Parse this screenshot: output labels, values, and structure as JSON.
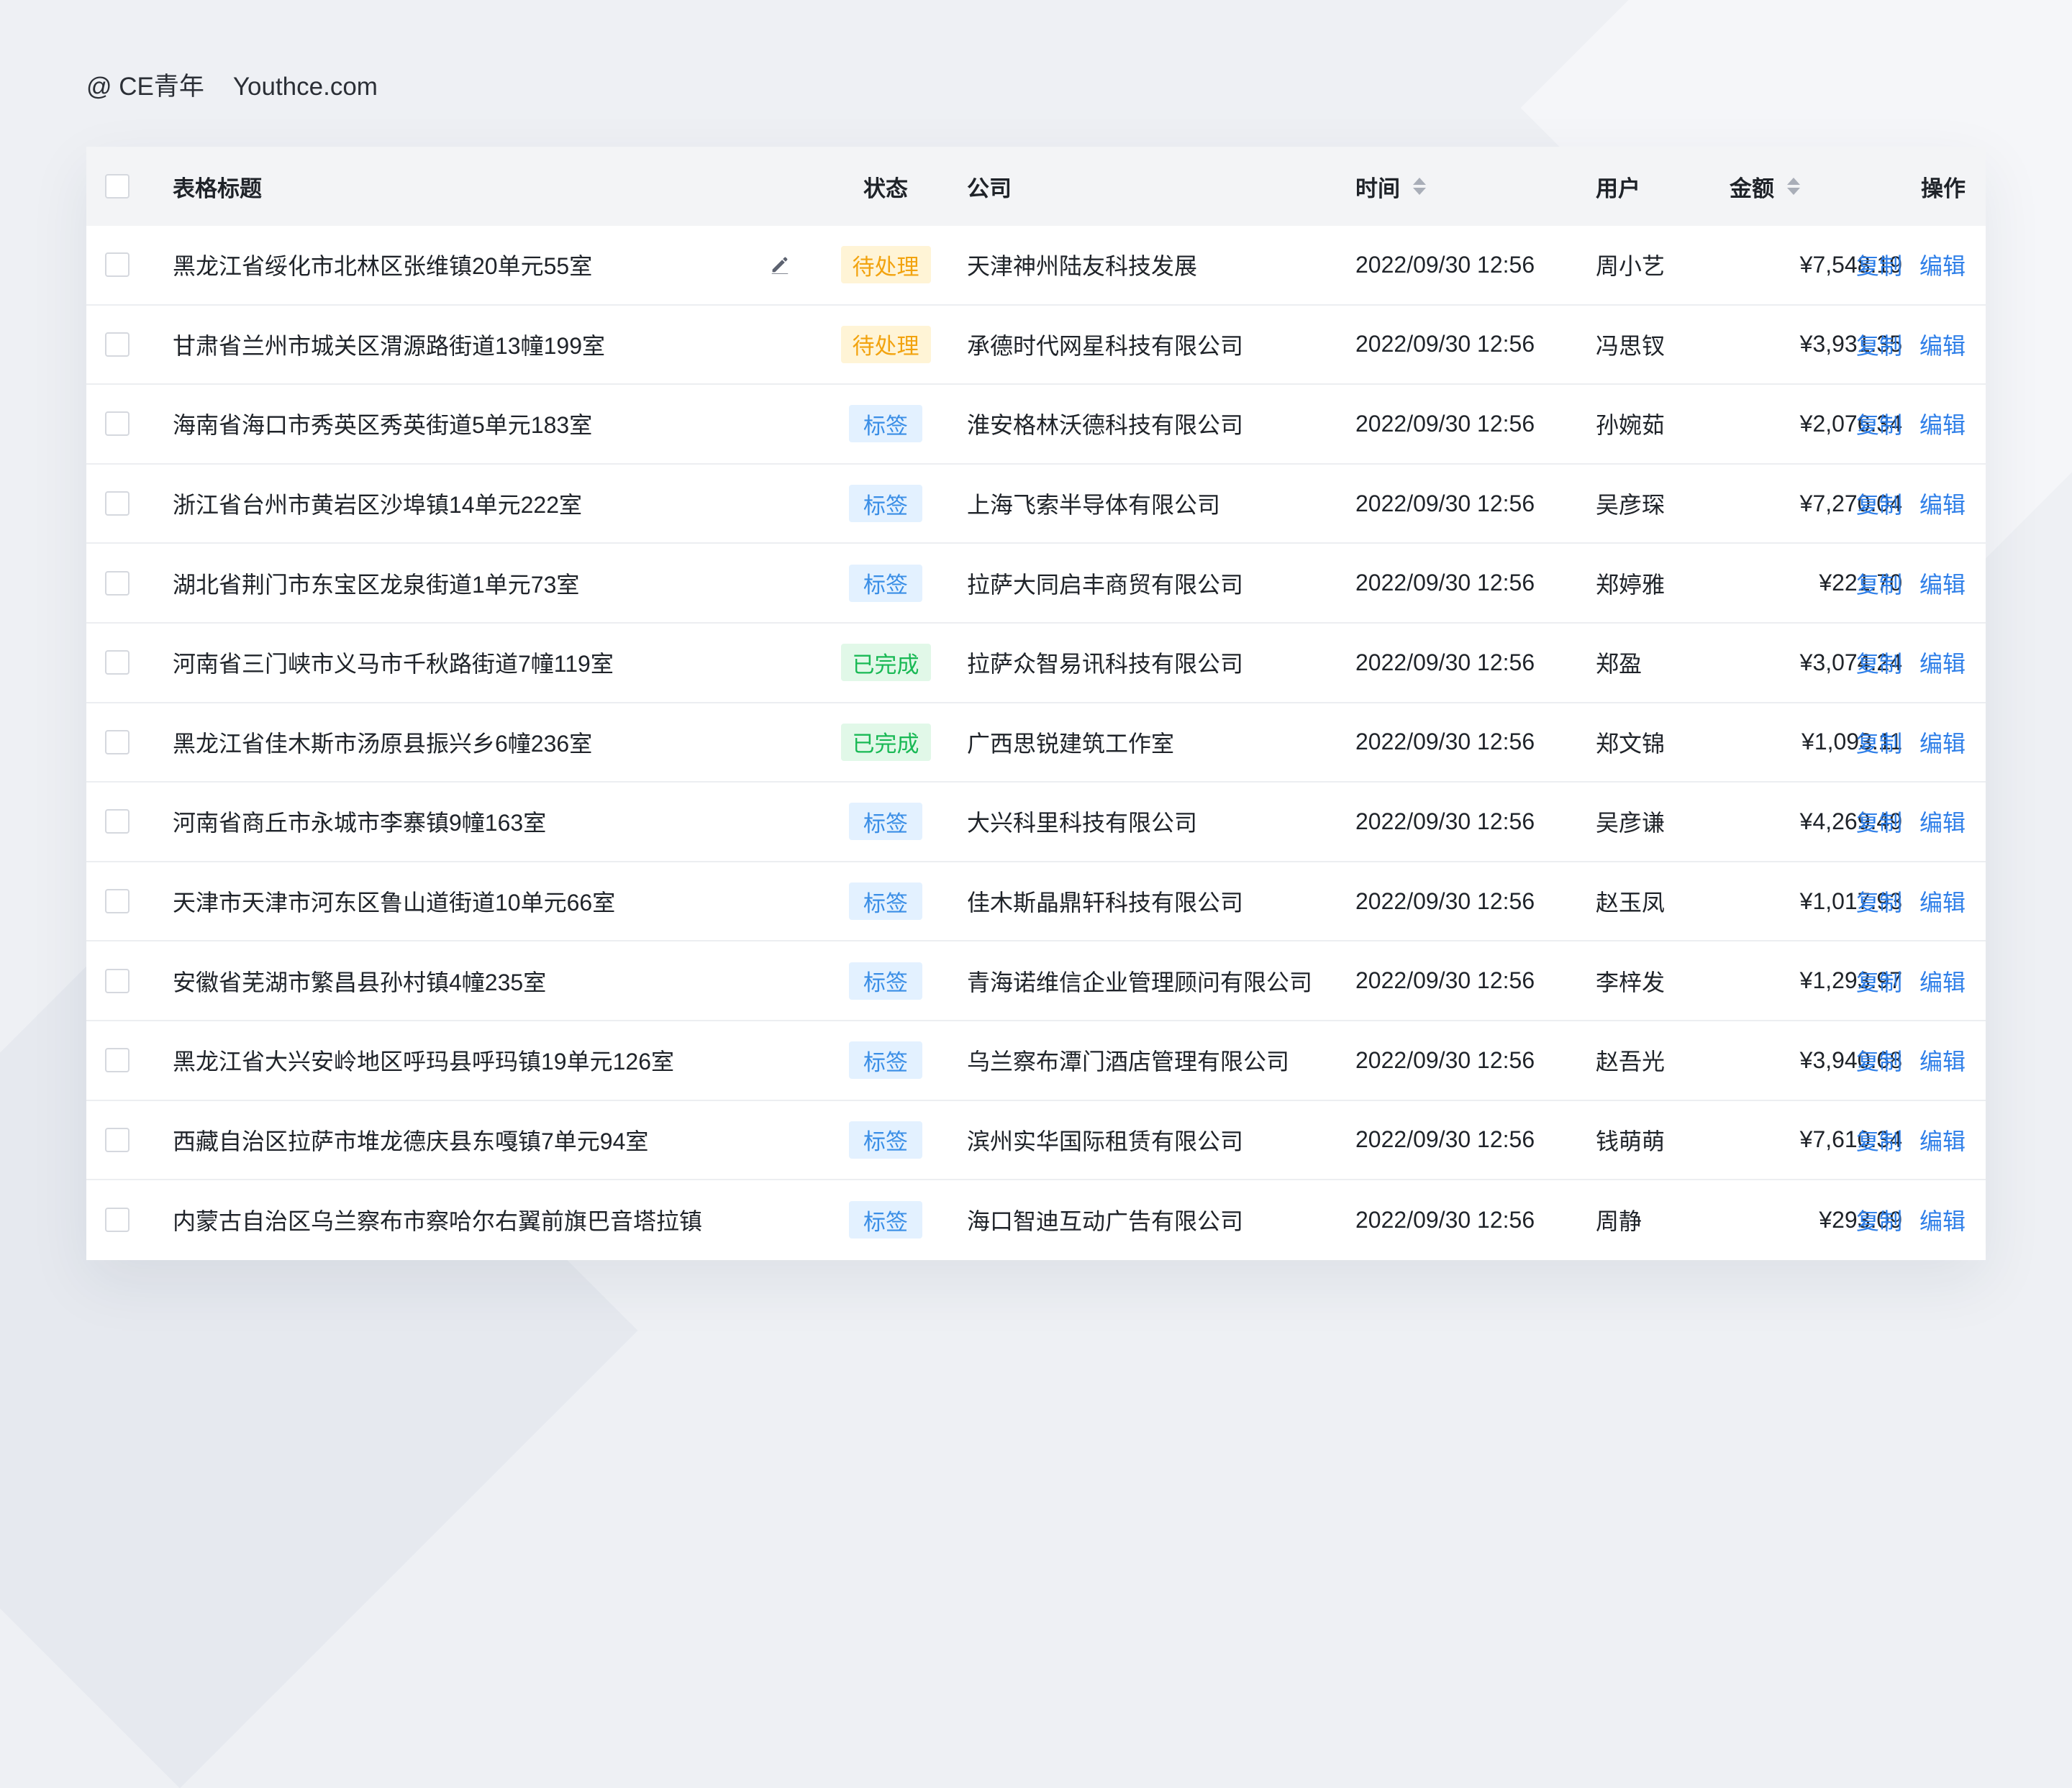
{
  "brand": {
    "handle": "@ CE青年",
    "site": "Youthce.com"
  },
  "colors": {
    "accent": "#2f7fe8",
    "pending": "#f2a30f",
    "label": "#3a8ee6",
    "done": "#19b955"
  },
  "table": {
    "headers": {
      "title": "表格标题",
      "status": "状态",
      "company": "公司",
      "time": "时间",
      "user": "用户",
      "amount": "金额",
      "ops": "操作"
    },
    "actions": {
      "copy": "复制",
      "edit": "编辑"
    },
    "rows": [
      {
        "title": "黑龙江省绥化市北林区张维镇20单元55室",
        "status": "待处理",
        "status_kind": "pending",
        "company": "天津神州陆友科技发展",
        "time": "2022/09/30 12:56",
        "user": "周小艺",
        "amount": "¥7,548.19",
        "editable": true
      },
      {
        "title": "甘肃省兰州市城关区渭源路街道13幢199室",
        "status": "待处理",
        "status_kind": "pending",
        "company": "承德时代网星科技有限公司",
        "time": "2022/09/30 12:56",
        "user": "冯思钗",
        "amount": "¥3,931.35"
      },
      {
        "title": "海南省海口市秀英区秀英街道5单元183室",
        "status": "标签",
        "status_kind": "label",
        "company": "淮安格林沃德科技有限公司",
        "time": "2022/09/30 12:56",
        "user": "孙婉茹",
        "amount": "¥2,076.34"
      },
      {
        "title": "浙江省台州市黄岩区沙埠镇14单元222室",
        "status": "标签",
        "status_kind": "label",
        "company": "上海飞索半导体有限公司",
        "time": "2022/09/30 12:56",
        "user": "吴彦琛",
        "amount": "¥7,270.04"
      },
      {
        "title": "湖北省荆门市东宝区龙泉街道1单元73室",
        "status": "标签",
        "status_kind": "label",
        "company": "拉萨大同启丰商贸有限公司",
        "time": "2022/09/30 12:56",
        "user": "郑婷雅",
        "amount": "¥221.70"
      },
      {
        "title": "河南省三门峡市义马市千秋路街道7幢119室",
        "status": "已完成",
        "status_kind": "done",
        "company": "拉萨众智易讯科技有限公司",
        "time": "2022/09/30 12:56",
        "user": "郑盈",
        "amount": "¥3,074.24"
      },
      {
        "title": "黑龙江省佳木斯市汤原县振兴乡6幢236室",
        "status": "已完成",
        "status_kind": "done",
        "company": "广西思锐建筑工作室",
        "time": "2022/09/30 12:56",
        "user": "郑文锦",
        "amount": "¥1,093.11"
      },
      {
        "title": "河南省商丘市永城市李寨镇9幢163室",
        "status": "标签",
        "status_kind": "label",
        "company": "大兴科里科技有限公司",
        "time": "2022/09/30 12:56",
        "user": "吴彦谦",
        "amount": "¥4,269.49"
      },
      {
        "title": "天津市天津市河东区鲁山道街道10单元66室",
        "status": "标签",
        "status_kind": "label",
        "company": "佳木斯晶鼎轩科技有限公司",
        "time": "2022/09/30 12:56",
        "user": "赵玉凤",
        "amount": "¥1,017.93"
      },
      {
        "title": "安徽省芜湖市繁昌县孙村镇4幢235室",
        "status": "标签",
        "status_kind": "label",
        "company": "青海诺维信企业管理顾问有限公司",
        "time": "2022/09/30 12:56",
        "user": "李梓发",
        "amount": "¥1,293.97"
      },
      {
        "title": "黑龙江省大兴安岭地区呼玛县呼玛镇19单元126室",
        "status": "标签",
        "status_kind": "label",
        "company": "乌兰察布潭门酒店管理有限公司",
        "time": "2022/09/30 12:56",
        "user": "赵吾光",
        "amount": "¥3,940.68"
      },
      {
        "title": "西藏自治区拉萨市堆龙德庆县东嘎镇7单元94室",
        "status": "标签",
        "status_kind": "label",
        "company": "滨州实华国际租赁有限公司",
        "time": "2022/09/30 12:56",
        "user": "钱萌萌",
        "amount": "¥7,610.34"
      },
      {
        "title": "内蒙古自治区乌兰察布市察哈尔右翼前旗巴音塔拉镇",
        "status": "标签",
        "status_kind": "label",
        "company": "海口智迪互动广告有限公司",
        "time": "2022/09/30 12:56",
        "user": "周静",
        "amount": "¥293.09"
      }
    ]
  }
}
